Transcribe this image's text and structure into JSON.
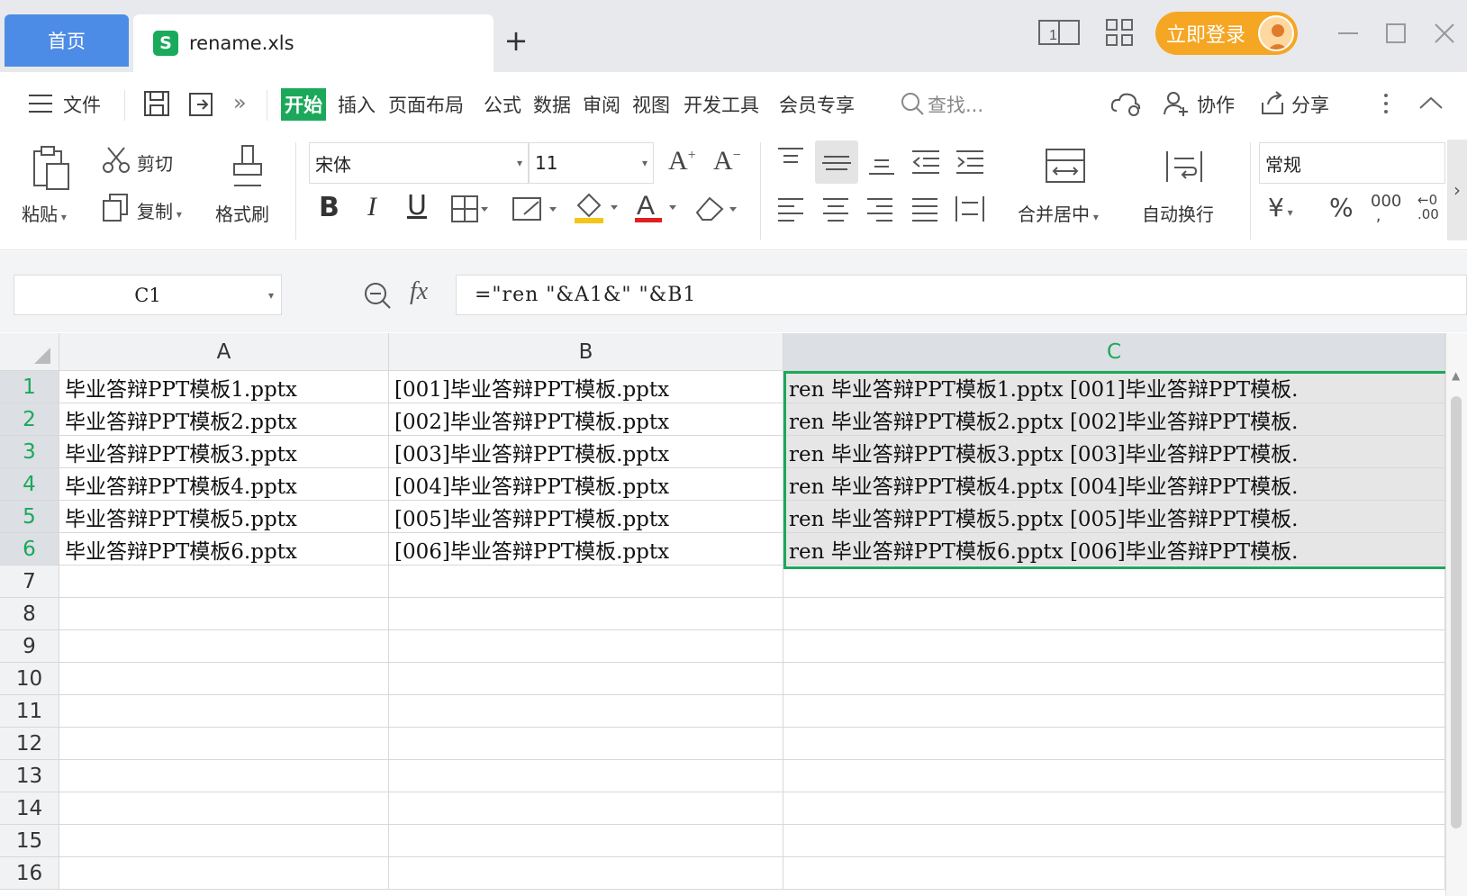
{
  "tabs": {
    "home": "首页",
    "file": "rename.xls",
    "file_logo": "S"
  },
  "titlebar": {
    "login": "立即登录"
  },
  "menu": {
    "file": "文件",
    "start": "开始",
    "insert": "插入",
    "layout": "页面布局",
    "formula": "公式",
    "data": "数据",
    "review": "审阅",
    "view": "视图",
    "dev": "开发工具",
    "member": "会员专享",
    "search": "查找...",
    "collab": "协作",
    "share": "分享"
  },
  "ribbon": {
    "paste": "粘贴",
    "cut": "剪切",
    "copy": "复制",
    "format_painter": "格式刷",
    "font": "宋体",
    "size": "11",
    "merge": "合并居中",
    "wrap": "自动换行",
    "number_format": "常规"
  },
  "formula_bar": {
    "namebox": "C1",
    "fx": "fx",
    "formula": "=\"ren \"&A1&\" \"&B1"
  },
  "columns": [
    "A",
    "B",
    "C"
  ],
  "rows": [
    "1",
    "2",
    "3",
    "4",
    "5",
    "6",
    "7",
    "8",
    "9",
    "10",
    "11",
    "12",
    "13",
    "14",
    "15",
    "16"
  ],
  "cells": {
    "A": [
      "毕业答辩PPT模板1.pptx",
      "毕业答辩PPT模板2.pptx",
      "毕业答辩PPT模板3.pptx",
      "毕业答辩PPT模板4.pptx",
      "毕业答辩PPT模板5.pptx",
      "毕业答辩PPT模板6.pptx"
    ],
    "B": [
      "[001]毕业答辩PPT模板.pptx",
      "[002]毕业答辩PPT模板.pptx",
      "[003]毕业答辩PPT模板.pptx",
      "[004]毕业答辩PPT模板.pptx",
      "[005]毕业答辩PPT模板.pptx",
      "[006]毕业答辩PPT模板.pptx"
    ],
    "C": [
      "ren 毕业答辩PPT模板1.pptx [001]毕业答辩PPT模板.",
      "ren 毕业答辩PPT模板2.pptx [002]毕业答辩PPT模板.",
      "ren 毕业答辩PPT模板3.pptx [003]毕业答辩PPT模板.",
      "ren 毕业答辩PPT模板4.pptx [004]毕业答辩PPT模板.",
      "ren 毕业答辩PPT模板5.pptx [005]毕业答辩PPT模板.",
      "ren 毕业答辩PPT模板6.pptx [006]毕业答辩PPT模板."
    ]
  },
  "colors": {
    "accent": "#1ba85a",
    "home_tab": "#4d8ce6",
    "login": "#f5a623"
  }
}
